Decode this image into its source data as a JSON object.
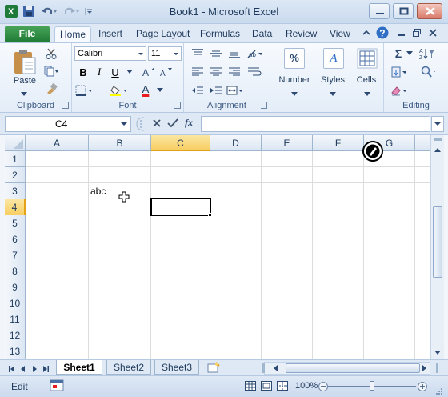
{
  "window": {
    "title": "Book1  -  Microsoft Excel"
  },
  "tabs": {
    "file": "File",
    "items": [
      "Home",
      "Insert",
      "Page Layout",
      "Formulas",
      "Data",
      "Review",
      "View"
    ],
    "active": "Home"
  },
  "ribbon": {
    "clipboard": {
      "label": "Clipboard",
      "paste": "Paste"
    },
    "font": {
      "label": "Font",
      "name": "Calibri",
      "size": "11",
      "bold": "B",
      "italic": "I",
      "underline": "U",
      "font_color": "A",
      "font_color_hex": "#e81c1c"
    },
    "alignment": {
      "label": "Alignment"
    },
    "number": {
      "label": "Number",
      "icon_text": "%"
    },
    "styles": {
      "label": "Styles",
      "icon_text": "A"
    },
    "cells": {
      "label": "Cells"
    },
    "editing": {
      "label": "Editing",
      "sigma": "Σ"
    }
  },
  "formula_bar": {
    "name_box": "C4",
    "fx": "fx",
    "value": ""
  },
  "grid": {
    "columns": [
      "A",
      "B",
      "C",
      "D",
      "E",
      "F",
      "G"
    ],
    "rows": [
      "1",
      "2",
      "3",
      "4",
      "5",
      "6",
      "7",
      "8",
      "9",
      "10",
      "11",
      "12",
      "13"
    ],
    "selected_column": "C",
    "selected_row": "4",
    "cells": {
      "B3": "abc"
    }
  },
  "sheets": {
    "items": [
      "Sheet1",
      "Sheet2",
      "Sheet3"
    ],
    "active": "Sheet1"
  },
  "status": {
    "mode": "Edit",
    "zoom": "100%"
  },
  "colors": {
    "accent_green": "#217a37",
    "selection_orange": "#f7cf63"
  }
}
